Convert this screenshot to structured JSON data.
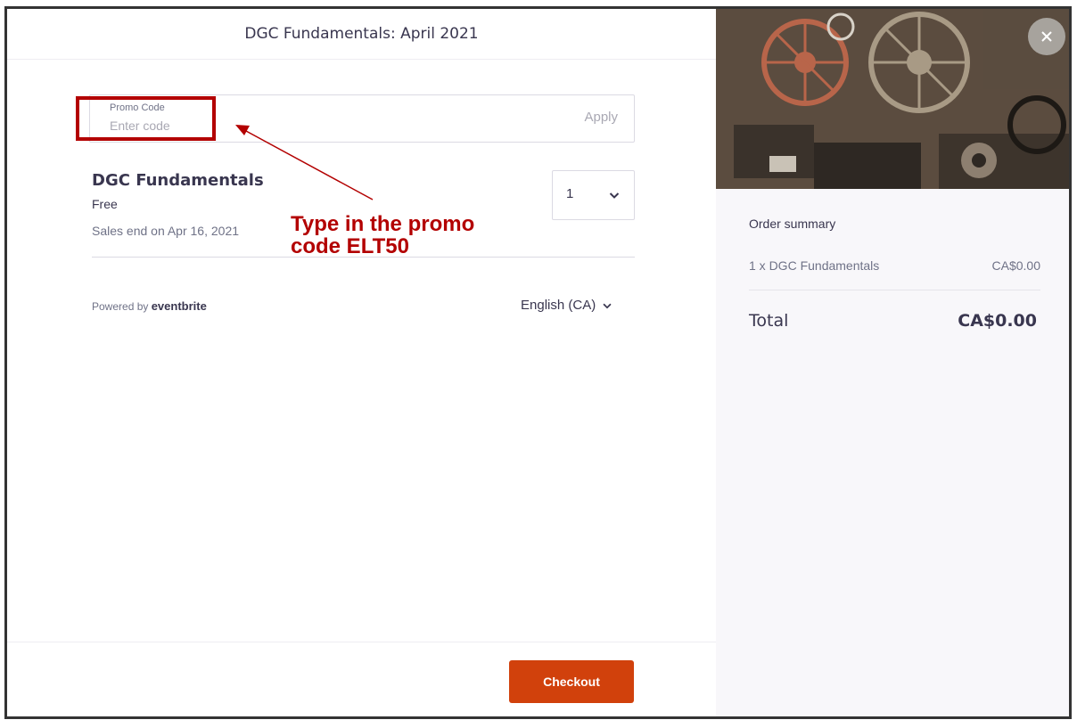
{
  "header": {
    "title": "DGC Fundamentals: April 2021"
  },
  "promo": {
    "label": "Promo Code",
    "placeholder": "Enter code",
    "apply_label": "Apply"
  },
  "ticket": {
    "name": "DGC Fundamentals",
    "price": "Free",
    "sales_end": "Sales end on Apr 16, 2021",
    "quantity": "1"
  },
  "footer": {
    "powered_prefix": "Powered by ",
    "powered_brand": "eventbrite",
    "language": "English (CA)",
    "checkout_label": "Checkout"
  },
  "annotation": {
    "text": "Type in the promo\ncode ELT50",
    "color": "#b30000"
  },
  "summary": {
    "title": "Order summary",
    "line_item": "1 x DGC Fundamentals",
    "line_price": "CA$0.00",
    "total_label": "Total",
    "total_value": "CA$0.00"
  },
  "icons": {
    "close": "close-icon",
    "chevron": "chevron-down-icon"
  },
  "colors": {
    "checkout": "#d1410c",
    "highlight": "#b30000"
  }
}
